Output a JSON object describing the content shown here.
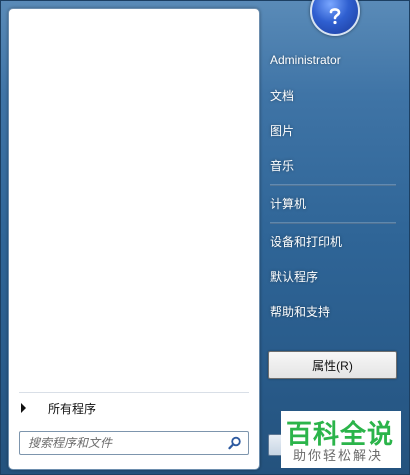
{
  "start_menu": {
    "all_programs_label": "所有程序",
    "search_placeholder": "搜索程序和文件"
  },
  "user": {
    "picture_icon": "help-question-icon"
  },
  "right_pane": {
    "items": [
      {
        "label": "Administrator"
      },
      {
        "label": "文档"
      },
      {
        "label": "图片"
      },
      {
        "label": "音乐"
      },
      {
        "label": "计算机"
      },
      {
        "label": "设备和打印机"
      },
      {
        "label": "默认程序"
      },
      {
        "label": "帮助和支持"
      }
    ]
  },
  "context_menu": {
    "properties_label": "属性(R)"
  },
  "watermark": {
    "title": "百科全说",
    "subtitle": "助你轻松解决",
    "color": "#2bb44a"
  }
}
